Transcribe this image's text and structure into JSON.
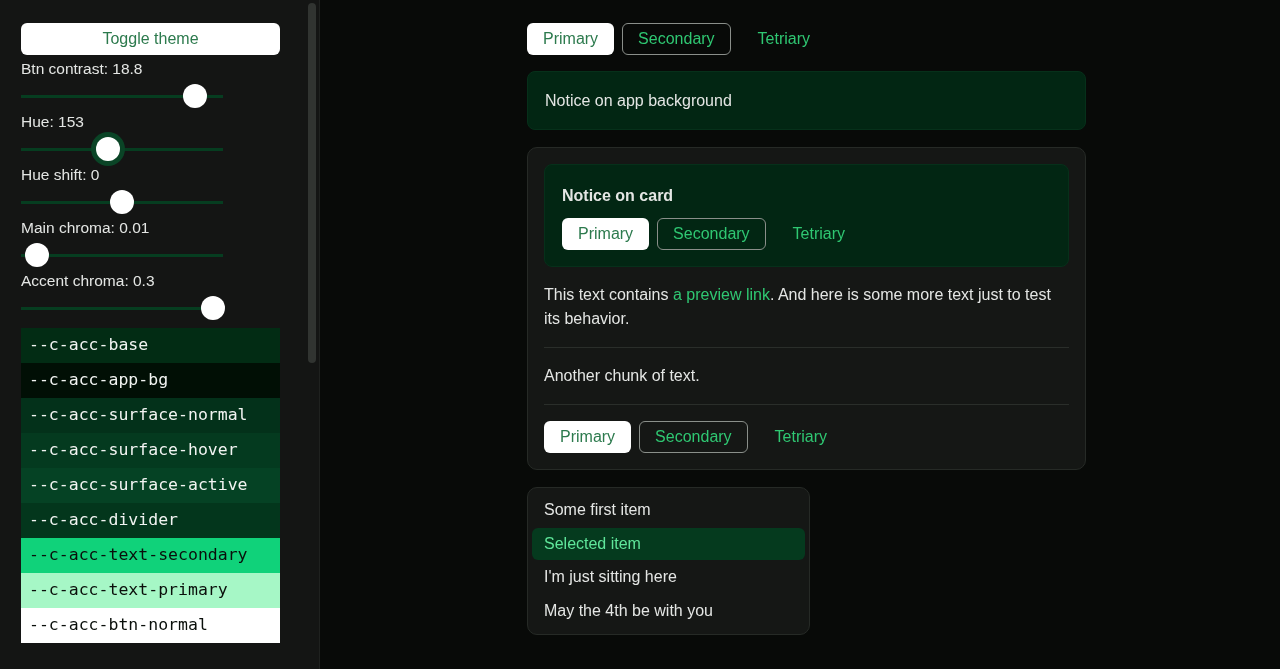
{
  "sidebar": {
    "toggle_button": "Toggle theme",
    "sliders": [
      {
        "label": "Btn contrast: 18.8",
        "level": 0.86,
        "focused": false
      },
      {
        "label": "Hue: 153",
        "level": 0.43,
        "focused": true
      },
      {
        "label": "Hue shift: 0",
        "level": 0.5,
        "focused": false
      },
      {
        "label": "Main chroma: 0.01",
        "level": 0.08,
        "focused": false
      },
      {
        "label": "Accent chroma: 0.3",
        "level": 0.95,
        "focused": false
      }
    ],
    "swatches": [
      {
        "name": "--c-acc-base",
        "color": "#022c14"
      },
      {
        "name": "--c-acc-app-bg",
        "color": "#010f05"
      },
      {
        "name": "--c-acc-surface-normal",
        "color": "#03311a"
      },
      {
        "name": "--c-acc-surface-hover",
        "color": "#043a1f"
      },
      {
        "name": "--c-acc-surface-active",
        "color": "#054224"
      },
      {
        "name": "--c-acc-divider",
        "color": "#03361c"
      },
      {
        "name": "--c-acc-text-secondary",
        "color": "#10d27a"
      },
      {
        "name": "--c-acc-text-primary",
        "color": "#a6f7c6"
      },
      {
        "name": "--c-acc-btn-normal",
        "color": "#ffffff"
      }
    ]
  },
  "main": {
    "top_buttons": [
      {
        "label": "Primary",
        "kind": "primary"
      },
      {
        "label": "Secondary",
        "kind": "secondary"
      },
      {
        "label": "Tetriary",
        "kind": "tertiary"
      }
    ],
    "app_notice": "Notice on app background",
    "card": {
      "notice_title": "Notice on card",
      "notice_buttons": [
        {
          "label": "Primary",
          "kind": "primary"
        },
        {
          "label": "Secondary",
          "kind": "secondary"
        },
        {
          "label": "Tetriary",
          "kind": "tertiary"
        }
      ],
      "paragraph": {
        "before": "This text contains ",
        "link": "a preview link",
        "after": ". And here is some more text just to test its behavior."
      },
      "paragraph_2": "Another chunk of text.",
      "buttons": [
        {
          "label": "Primary",
          "kind": "primary"
        },
        {
          "label": "Secondary",
          "kind": "secondary"
        },
        {
          "label": "Tetriary",
          "kind": "tertiary"
        }
      ]
    },
    "menu": [
      {
        "label": "Some first item",
        "selected": false
      },
      {
        "label": "Selected item",
        "selected": true
      },
      {
        "label": "I'm just sitting here",
        "selected": false
      },
      {
        "label": "May the 4th be with you",
        "selected": false
      }
    ]
  }
}
